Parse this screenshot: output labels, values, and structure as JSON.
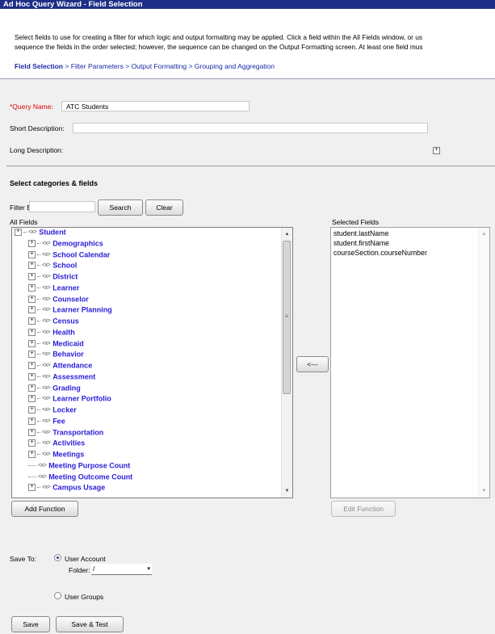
{
  "window": {
    "title": "Ad Hoc Query Wizard - Field Selection"
  },
  "instructions": {
    "line1": "Select fields to use for creating a filter for which logic and output formatting may be applied. Click a field within the All Fields window, or us",
    "line2": "sequence the fields in the order selected; however, the sequence can be changed on the Output Formatting screen. At least one field mus"
  },
  "wizard_steps": {
    "current": "Field Selection",
    "separator": " > ",
    "steps": [
      "Filter Parameters",
      "Output Formatting",
      "Grouping and Aggregation"
    ]
  },
  "query": {
    "required_marker": "*",
    "name_label": "Query Name:",
    "name_value": "ATC Students",
    "short_desc_label": "Short Description:",
    "short_desc_value": "",
    "long_desc_label": "Long Description:",
    "expand_symbol": "+"
  },
  "fields_section": {
    "title": "Select categories & fields",
    "filter_by_label": "Filter By",
    "filter_value": "",
    "search_button": "Search",
    "clear_button": "Clear",
    "all_fields_label": "All Fields",
    "selected_fields_label": "Selected Fields",
    "move_button": "<---",
    "add_function_button": "Add Function",
    "edit_function_button": "Edit Function",
    "all_fields": [
      {
        "label": "Student",
        "type": "root"
      },
      {
        "label": "Demographics",
        "type": "expandable"
      },
      {
        "label": "School Calendar",
        "type": "expandable"
      },
      {
        "label": "School",
        "type": "expandable"
      },
      {
        "label": "District",
        "type": "expandable"
      },
      {
        "label": "Learner",
        "type": "expandable"
      },
      {
        "label": "Counselor",
        "type": "expandable"
      },
      {
        "label": "Learner Planning",
        "type": "expandable"
      },
      {
        "label": "Census",
        "type": "expandable"
      },
      {
        "label": "Health",
        "type": "expandable"
      },
      {
        "label": "Medicaid",
        "type": "expandable"
      },
      {
        "label": "Behavior",
        "type": "expandable"
      },
      {
        "label": "Attendance",
        "type": "expandable"
      },
      {
        "label": "Assessment",
        "type": "expandable"
      },
      {
        "label": "Grading",
        "type": "expandable"
      },
      {
        "label": "Learner Portfolio",
        "type": "expandable"
      },
      {
        "label": "Locker",
        "type": "expandable"
      },
      {
        "label": "Fee",
        "type": "expandable"
      },
      {
        "label": "Transportation",
        "type": "expandable"
      },
      {
        "label": "Activities",
        "type": "expandable"
      },
      {
        "label": "Meetings",
        "type": "expandable"
      },
      {
        "label": "Meeting Purpose Count",
        "type": "leaf"
      },
      {
        "label": "Meeting Outcome Count",
        "type": "leaf"
      },
      {
        "label": "Campus Usage",
        "type": "expandable"
      }
    ],
    "selected_fields": [
      "student.lastName",
      "student.firstName",
      "courseSection.courseNumber"
    ],
    "expand_symbol": "+",
    "category_icon": "<x>",
    "scroll_up": "▲",
    "scroll_down": "▼",
    "scroll_grip": "≡"
  },
  "save": {
    "save_to_label": "Save To:",
    "user_account_label": "User Account",
    "folder_label": "Folder:",
    "folder_value": "/",
    "dropdown_arrow": "▾",
    "user_groups_label": "User Groups",
    "selected_option": "User Account",
    "save_button": "Save",
    "save_test_button": "Save & Test"
  }
}
